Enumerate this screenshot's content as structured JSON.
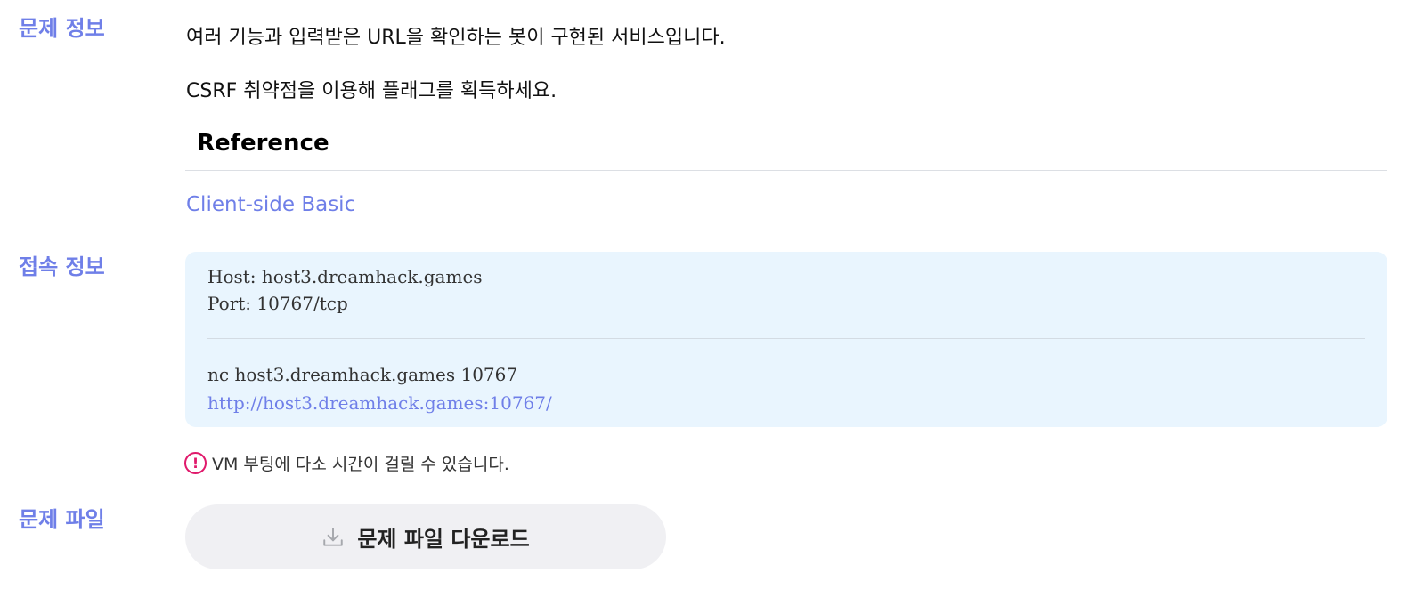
{
  "sections": {
    "info_label": "문제 정보",
    "connection_label": "접속 정보",
    "file_label": "문제 파일"
  },
  "description": {
    "line1": "여러 기능과 입력받은 URL을 확인하는 봇이 구현된 서비스입니다.",
    "line2": "CSRF 취약점을 이용해 플래그를 획득하세요."
  },
  "reference": {
    "heading": "Reference",
    "link_text": "Client-side Basic"
  },
  "connection": {
    "host": "Host: host3.dreamhack.games",
    "port": "Port: 10767/tcp",
    "nc_command": "nc host3.dreamhack.games 10767",
    "url": "http://host3.dreamhack.games:10767/"
  },
  "notice": {
    "icon": "exclamation-circle-icon",
    "text": "VM 부팅에 다소 시간이 걸릴 수 있습니다."
  },
  "download": {
    "icon": "download-icon",
    "label": "문제 파일 다운로드"
  },
  "colors": {
    "accent": "#6f7fe8",
    "connection_bg": "#e9f5fe",
    "warning": "#e0196b",
    "button_bg": "#f0f0f3"
  }
}
